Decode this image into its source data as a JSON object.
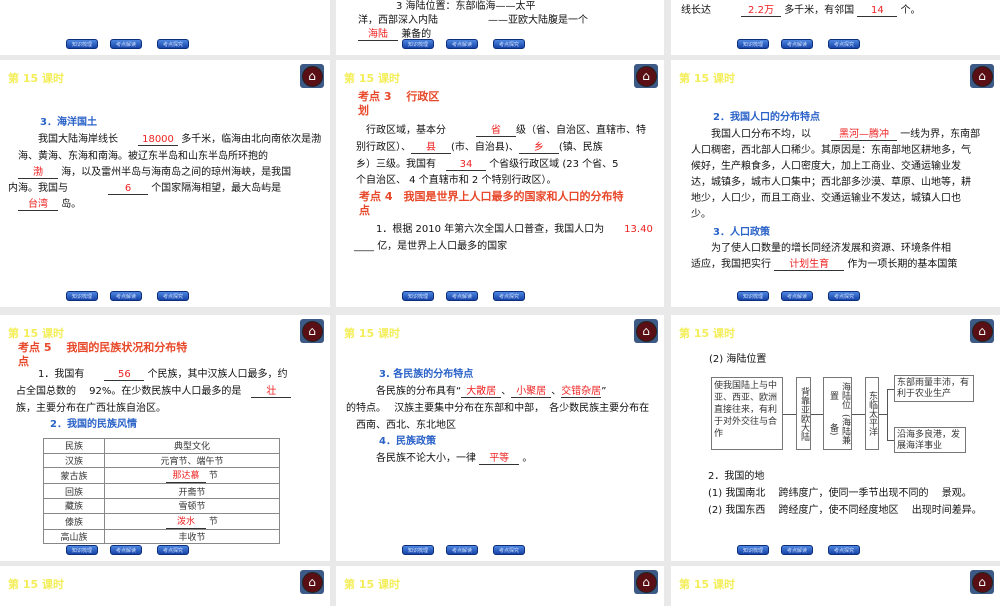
{
  "header": "第 15 课时",
  "nav": [
    "知识梳理",
    "考点解读",
    "考点探究"
  ],
  "top_mid": {
    "l1": "3 海陆位置：东部临海——太平",
    "l2a": "洋，西部深入内陆",
    "l2b": "——亚欧大陆腹是一个",
    "l3ans": "海陆",
    "l3b": "兼备的"
  },
  "top_right": {
    "a": "线长达",
    "ans1": "2.2万",
    "b": "多千米，有邻国",
    "ans2": "14",
    "c": "个。"
  },
  "s1": {
    "h": "3．海洋国土",
    "l1a": "我国大陆海岸线长",
    "l1ans": "18000",
    "l1b": "多千米，临海由北向南依次是渤",
    "l2": "海、黄海、东海和南海。被辽东半岛和山东半岛所环抱的",
    "l3ans": "渤",
    "l3b": "海，以及雷州半岛与海南岛之间的琼州海峡，是我国",
    "l4a": "内海。我国与",
    "l4ans": "6",
    "l4b": "个国家隔海相望，最大岛屿是",
    "l5ans": "台湾",
    "l5b": "岛。"
  },
  "s2": {
    "k3a": "考点 3　 行政区",
    "k3b": "划",
    "l1a": "行政区域，基本分",
    "l1ans": "省",
    "l1b": "级（省、自治区、直辖市、特",
    "l2a": "别行政区）、",
    "l2ans": "县",
    "l2b": "(市、自治县)、",
    "l2ans2": "乡",
    "l2c": "(镇、民族",
    "l3a": "乡）三级。我国有",
    "l3ans": "34",
    "l3b": "个省级行政区域 (23 个省、5",
    "l4": "个自治区、 4 个直辖市和 2 个特别行政区）。",
    "k4a": "考点 4　我国是世界上人口最多的国家和人口的分布特",
    "k4b": "点",
    "l5": "1．根据 2010 年第六次全国人口普查，我国人口为",
    "l5ans": "13.40",
    "l6": "亿，是世界上人口最多的国家"
  },
  "s3": {
    "h1": "2．我国人口的分布特点",
    "l1a": "我国人口分布不均，以",
    "l1ans": "黑河—腾冲",
    "l1b": "一线为界，东南部",
    "l2": "人口稠密，西北部人口稀少。其原因是：东南部地区耕地多，气",
    "l3": "候好，生产粮食多，人口密度大，加上工商业、交通运输业发",
    "l4": "达，城镇多，城市人口集中；西北部多沙漠、草原、山地等，耕",
    "l5": "地少，人口少，而且工商业、交通运输业不发达，城镇人口也",
    "l6": "少。",
    "h2": "3．人口政策",
    "l7": "为了使人口数量的增长同经济发展和资源、环境条件相",
    "l8a": "适应，我国把实行",
    "l8ans": "计划生育",
    "l8b": "作为一项长期的基本国策"
  },
  "s4": {
    "k5a": "考点 5　 我国的民族状况和分布特",
    "k5b": "点",
    "l1a": "1．我国有",
    "l1ans": "56",
    "l1b": "个民族，其中汉族人口最多，约",
    "l2a": "占全国总数的　 92%。在少数民族中人口最多的是",
    "l2ans": "壮",
    "l3": "族，主要分布在广西壮族自治区。",
    "h": "2．我国的民族风情",
    "table": {
      "headers": [
        "民族",
        "典型文化"
      ],
      "rows": [
        [
          "汉族",
          "元宵节、端午节",
          ""
        ],
        [
          "蒙古族",
          "那达慕",
          "节"
        ],
        [
          "回族",
          "开斋节",
          ""
        ],
        [
          "藏族",
          "雪顿节",
          ""
        ],
        [
          "傣族",
          "泼水",
          "节"
        ],
        [
          "高山族",
          "丰收节",
          ""
        ]
      ]
    }
  },
  "s5": {
    "h1": "3. 各民族的分布特点",
    "l1a": "各民族的分布具有“",
    "ans1": "大散居",
    "ans2": "小聚居",
    "ans3": "交错杂居",
    "l1b": "”",
    "l2": "的特点。　 汉族主要集中分布在东部和中部，　各少数民族主要分布在",
    "l3": "西南、西北、东北地区",
    "h2": "4．民族政策",
    "l4a": "各民族不论大小，一律",
    "l4ans": "平等",
    "l4b": "。"
  },
  "s6": {
    "h": "(2) 海陆位置",
    "b1": "使我国陆上与中亚、西亚、欧洲直接往来，有利于对外交往与合作",
    "b2": "背靠亚欧大陆",
    "b3a": "海陆位置",
    "b3b": "(海陆兼备)",
    "b4": "东临太平洋",
    "b5": "东部雨量丰沛，有利于农业生产",
    "b6": "沿海多良港，发展海洋事业",
    "l1": "2．我国的地",
    "l2": "(1) 我国南北　 跨纬度广，使同一季节出现不同的　 景观。",
    "l3": "(2) 我国东西　 跨经度广，使不同经度地区　 出现时间差异。"
  }
}
